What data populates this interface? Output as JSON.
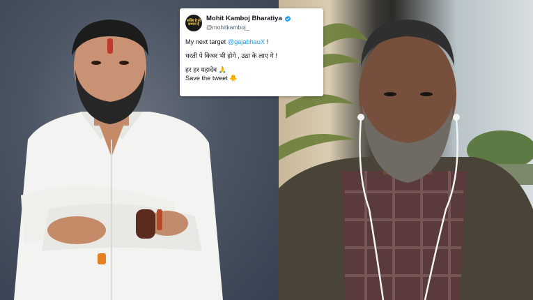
{
  "tweet": {
    "avatar_text": "शक्ति है तो सम्मान है",
    "display_name": "Mohit Kamboj Bharatiya",
    "handle": "@mohitkamboj_",
    "verified_icon": "verified-badge-icon",
    "line1_prefix": "My next target ",
    "line1_mention": "@gajabhauX",
    "line1_suffix": " !",
    "line2": "धरती पे किधर भी होगे , उठा के लाए गे !",
    "line3": "हर हर महादेव 🙏",
    "line4": "Save the tweet 🐥"
  },
  "colors": {
    "mention": "#1d9bf0",
    "verified": "#1d9bf0",
    "shirt_left": "#f5f5f5",
    "shirt_right": "#5a3a3a"
  }
}
